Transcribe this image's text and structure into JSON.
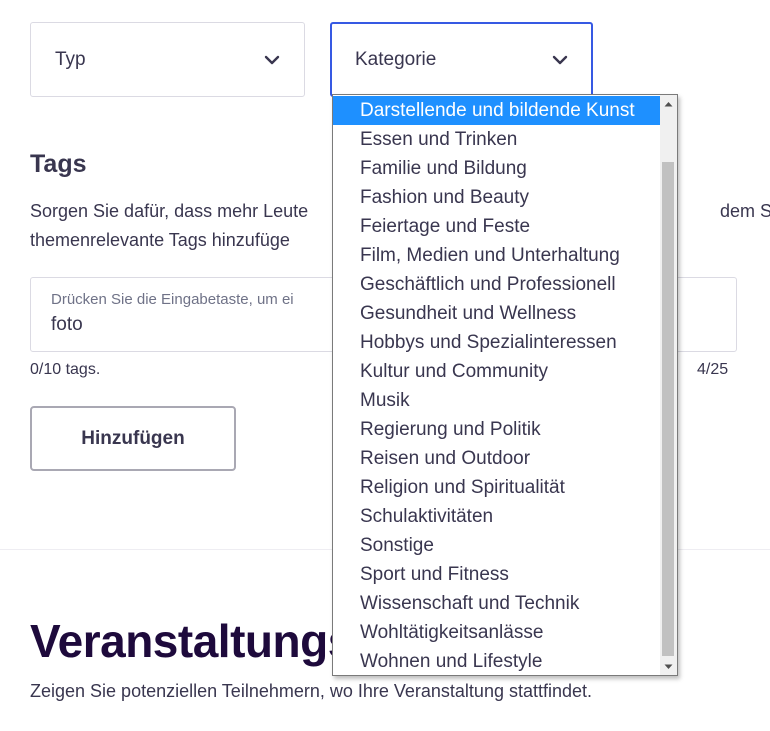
{
  "filters": {
    "type_label": "Typ",
    "category_label": "Kategorie"
  },
  "tags": {
    "heading": "Tags",
    "description_line1a": "Sorgen Sie dafür, dass mehr Leute",
    "description_line1b": "dem Sie",
    "description_line2": "themenrelevante Tags hinzufüge",
    "input_placeholder": "Drücken Sie die Eingabetaste, um ei",
    "input_value": "foto",
    "tag_count": "0/10 tags.",
    "char_count": "4/25",
    "add_button_label": "Hinzufügen"
  },
  "venue": {
    "heading": "Veranstaltungs",
    "description": "Zeigen Sie potenziellen Teilnehmern, wo Ihre Veranstaltung stattfindet."
  },
  "category_dropdown": {
    "selected_index": 0,
    "options": [
      "Darstellende und bildende Kunst",
      "Essen und Trinken",
      "Familie und Bildung",
      "Fashion und Beauty",
      "Feiertage und Feste",
      "Film, Medien und Unterhaltung",
      "Geschäftlich und Professionell",
      "Gesundheit und Wellness",
      "Hobbys und Spezialinteressen",
      "Kultur und Community",
      "Musik",
      "Regierung und Politik",
      "Reisen und Outdoor",
      "Religion und Spiritualität",
      "Schulaktivitäten",
      "Sonstige",
      "Sport und Fitness",
      "Wissenschaft und Technik",
      "Wohltätigkeitsanlässe",
      "Wohnen und Lifestyle"
    ]
  },
  "icons": {
    "type_chevron": "chevron-down-icon",
    "category_chevron": "chevron-down-icon",
    "scroll_up": "scroll-up-arrow-icon",
    "scroll_down": "scroll-down-arrow-icon"
  },
  "colors": {
    "focus_border": "#3659e3",
    "selected_option_bg": "#1e90ff",
    "heading_dark": "#1e0a3c"
  }
}
